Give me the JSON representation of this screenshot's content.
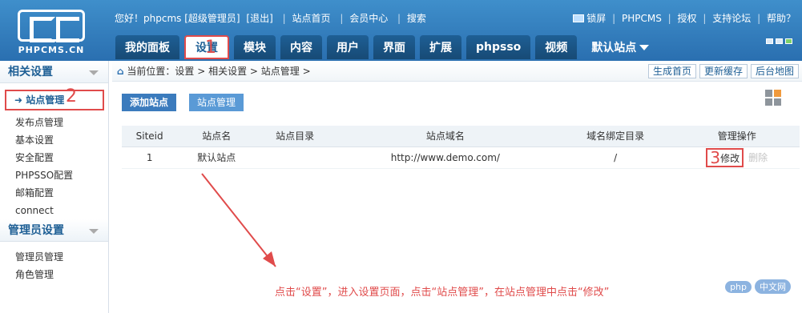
{
  "logo": {
    "text": "PHPCMS.CN"
  },
  "topbar": {
    "greeting": "您好！phpcms [超级管理员]",
    "logout": "[退出]",
    "home": "站点首页",
    "member": "会员中心",
    "search": "搜索",
    "lock": "锁屏",
    "brand": "PHPCMS",
    "license": "授权",
    "forum": "支持论坛",
    "help": "帮助？"
  },
  "nav": {
    "tabs": [
      "我的面板",
      "设置",
      "模块",
      "内容",
      "用户",
      "界面",
      "扩展",
      "phpsso",
      "视频"
    ],
    "site": "默认站点"
  },
  "sidebar": {
    "section1": "相关设置",
    "current": "站点管理",
    "items": [
      "发布点管理",
      "基本设置",
      "安全配置",
      "PHPSSO配置",
      "邮箱配置",
      "connect"
    ],
    "section2": "管理员设置",
    "items2": [
      "管理员管理",
      "角色管理"
    ]
  },
  "breadcrumb": "当前位置：设置 > 相关设置 > 站点管理 >",
  "quicklinks": [
    "生成首页",
    "更新缓存",
    "后台地图"
  ],
  "actions": {
    "add": "添加站点",
    "manage": "站点管理"
  },
  "table": {
    "headers": [
      "Siteid",
      "站点名",
      "站点目录",
      "站点域名",
      "域名绑定目录",
      "管理操作"
    ],
    "rows": [
      {
        "siteid": "1",
        "name": "默认站点",
        "dir": "",
        "domain": "http://www.demo.com/",
        "bind": "/",
        "edit": "修改",
        "delete": "删除"
      }
    ]
  },
  "annotations": {
    "m1": "1",
    "m2": "2",
    "m3": "3",
    "note": "点击“设置”，进入设置页面，点击“站点管理”，在站点管理中点击“修改”"
  },
  "watermark": {
    "badge": "php",
    "text": "中文网"
  }
}
